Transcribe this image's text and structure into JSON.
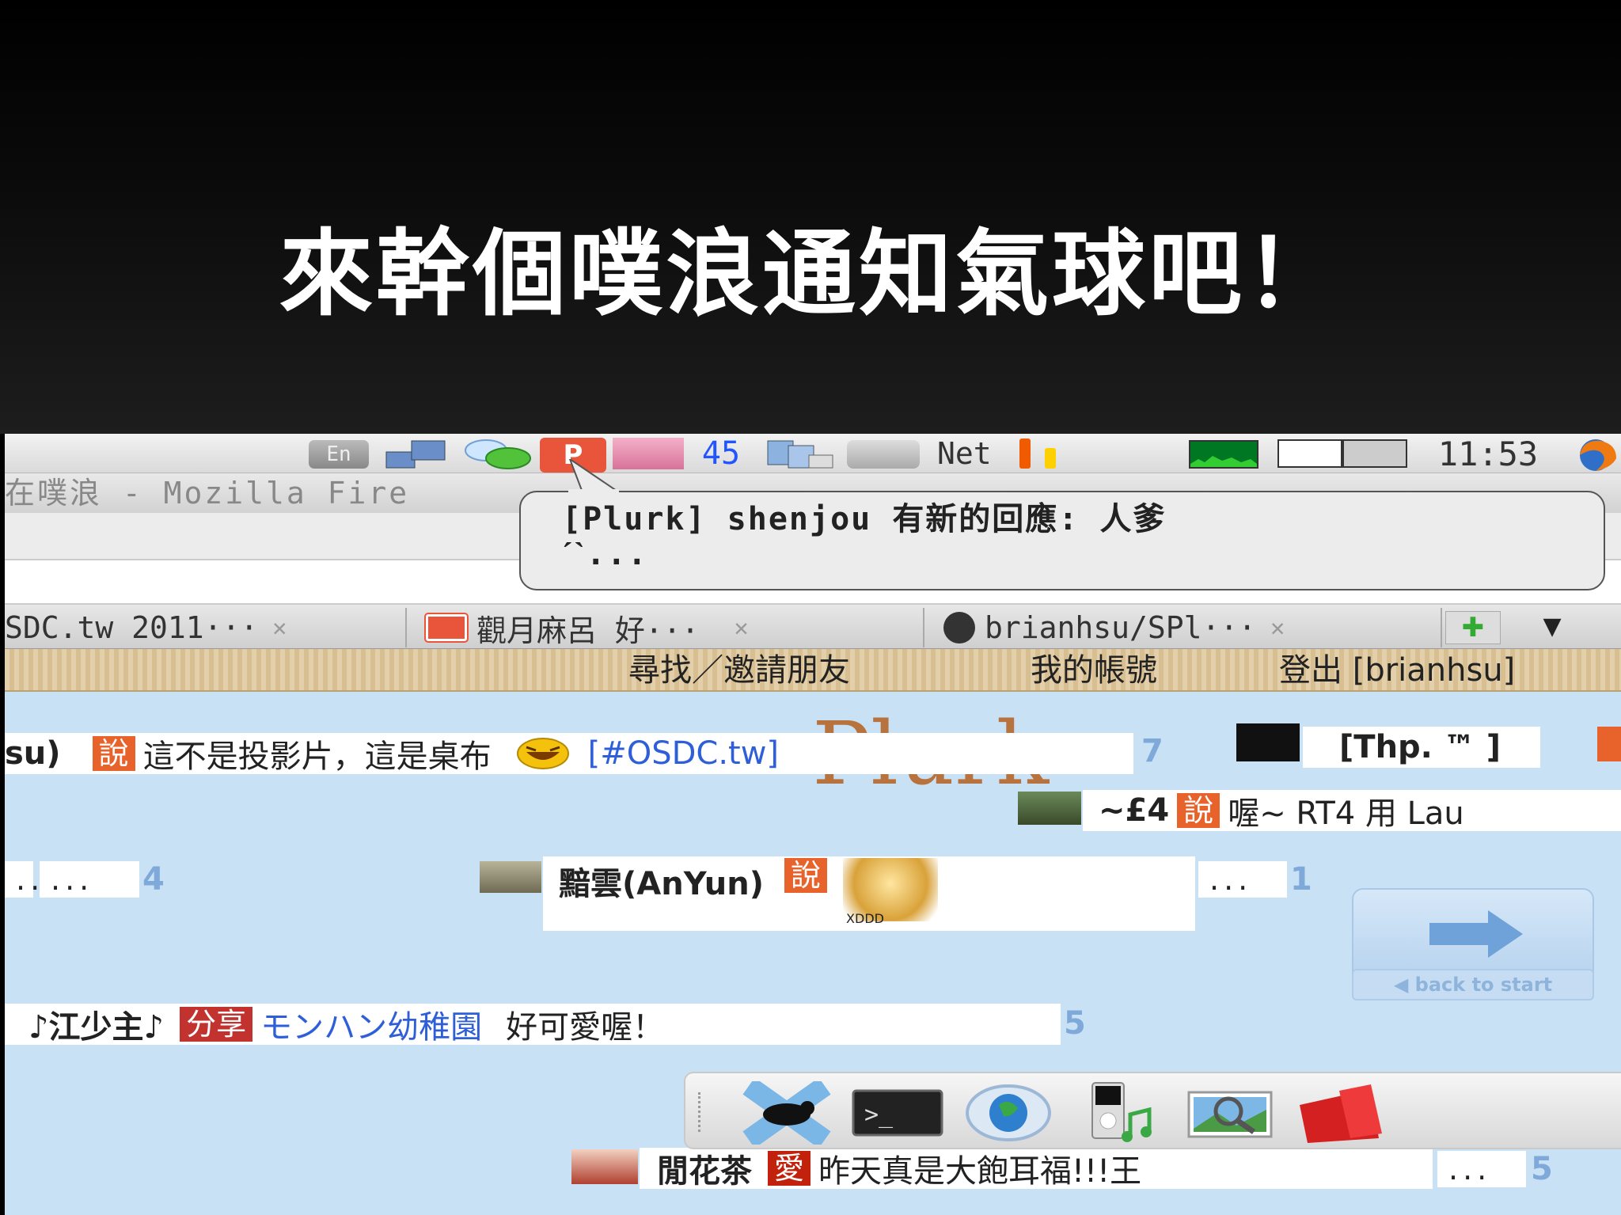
{
  "slide": {
    "title": "來幹個噗浪通知氣球吧！"
  },
  "panel": {
    "lang_indicator": "En",
    "plurk_icon": "P",
    "unread_count": "45",
    "net_label": "Net",
    "clock": "11:53",
    "icons": [
      "keyboard-icon",
      "network-icon",
      "chat-icon",
      "plurk-icon",
      "avatar-icon",
      "machines-icon",
      "blank-applet-icon",
      "net-monitor-icon",
      "cpu-graph-icon",
      "workspace-switcher-icon",
      "firefox-icon"
    ]
  },
  "window": {
    "title": "在噗浪 - Mozilla Fire"
  },
  "notification": {
    "line1": "[Plurk] shenjou 有新的回應: 人爹",
    "line2": "ˊˋ..."
  },
  "tabs": [
    {
      "label": "SDC.tw 2011···",
      "close": "✕"
    },
    {
      "label": "觀月麻呂 好···",
      "close": "✕"
    },
    {
      "label": "brianhsu/SPl···",
      "close": "✕"
    }
  ],
  "tab_add": "✚",
  "tab_list": "▼",
  "plurk_menu": {
    "find": "尋找／邀請朋友",
    "account": "我的帳號",
    "logout": "登出 [brianhsu]"
  },
  "timeline": {
    "row1": {
      "prefix": "su)",
      "qualifier": "說",
      "text": "這不是投影片，這是桌布",
      "tag": "[#OSDC.tw]",
      "count": "7"
    },
    "row1b": {
      "nick": "[Thp. ™ ]"
    },
    "row2": {
      "nick": "~£4",
      "qualifier": "說",
      "text": "喔~ RT4 用 Lau"
    },
    "row3": {
      "more": "...",
      "count": "4"
    },
    "row4": {
      "nick": "黯雲(AnYun)",
      "qualifier": "說",
      "img_caption": "XDDD",
      "more": "...",
      "count": "1"
    },
    "row5": {
      "nick": "♪江少主♪",
      "qualifier": "分享",
      "link": "モンハン幼稚園",
      "text": "好可愛喔！",
      "count": "5"
    },
    "row6": {
      "nick": "閒花茶",
      "qualifier": "愛",
      "text": "昨天真是大飽耳福!!!王",
      "more": "...",
      "count": "5"
    }
  },
  "watermark": "Plurk",
  "nav": {
    "back_to_start": "◀ back to start"
  },
  "dock_items": [
    "x-mouse-icon",
    "terminal-icon",
    "web-browser-icon",
    "music-player-icon",
    "image-viewer-icon",
    "folder-icon"
  ],
  "colors": {
    "qualifier_orange": "#e8632b",
    "qualifier_red": "#c2332f",
    "link_blue": "#2f5fd8",
    "count_blue": "#7fa9d9",
    "timeline_bg": "#c9e1f5"
  }
}
